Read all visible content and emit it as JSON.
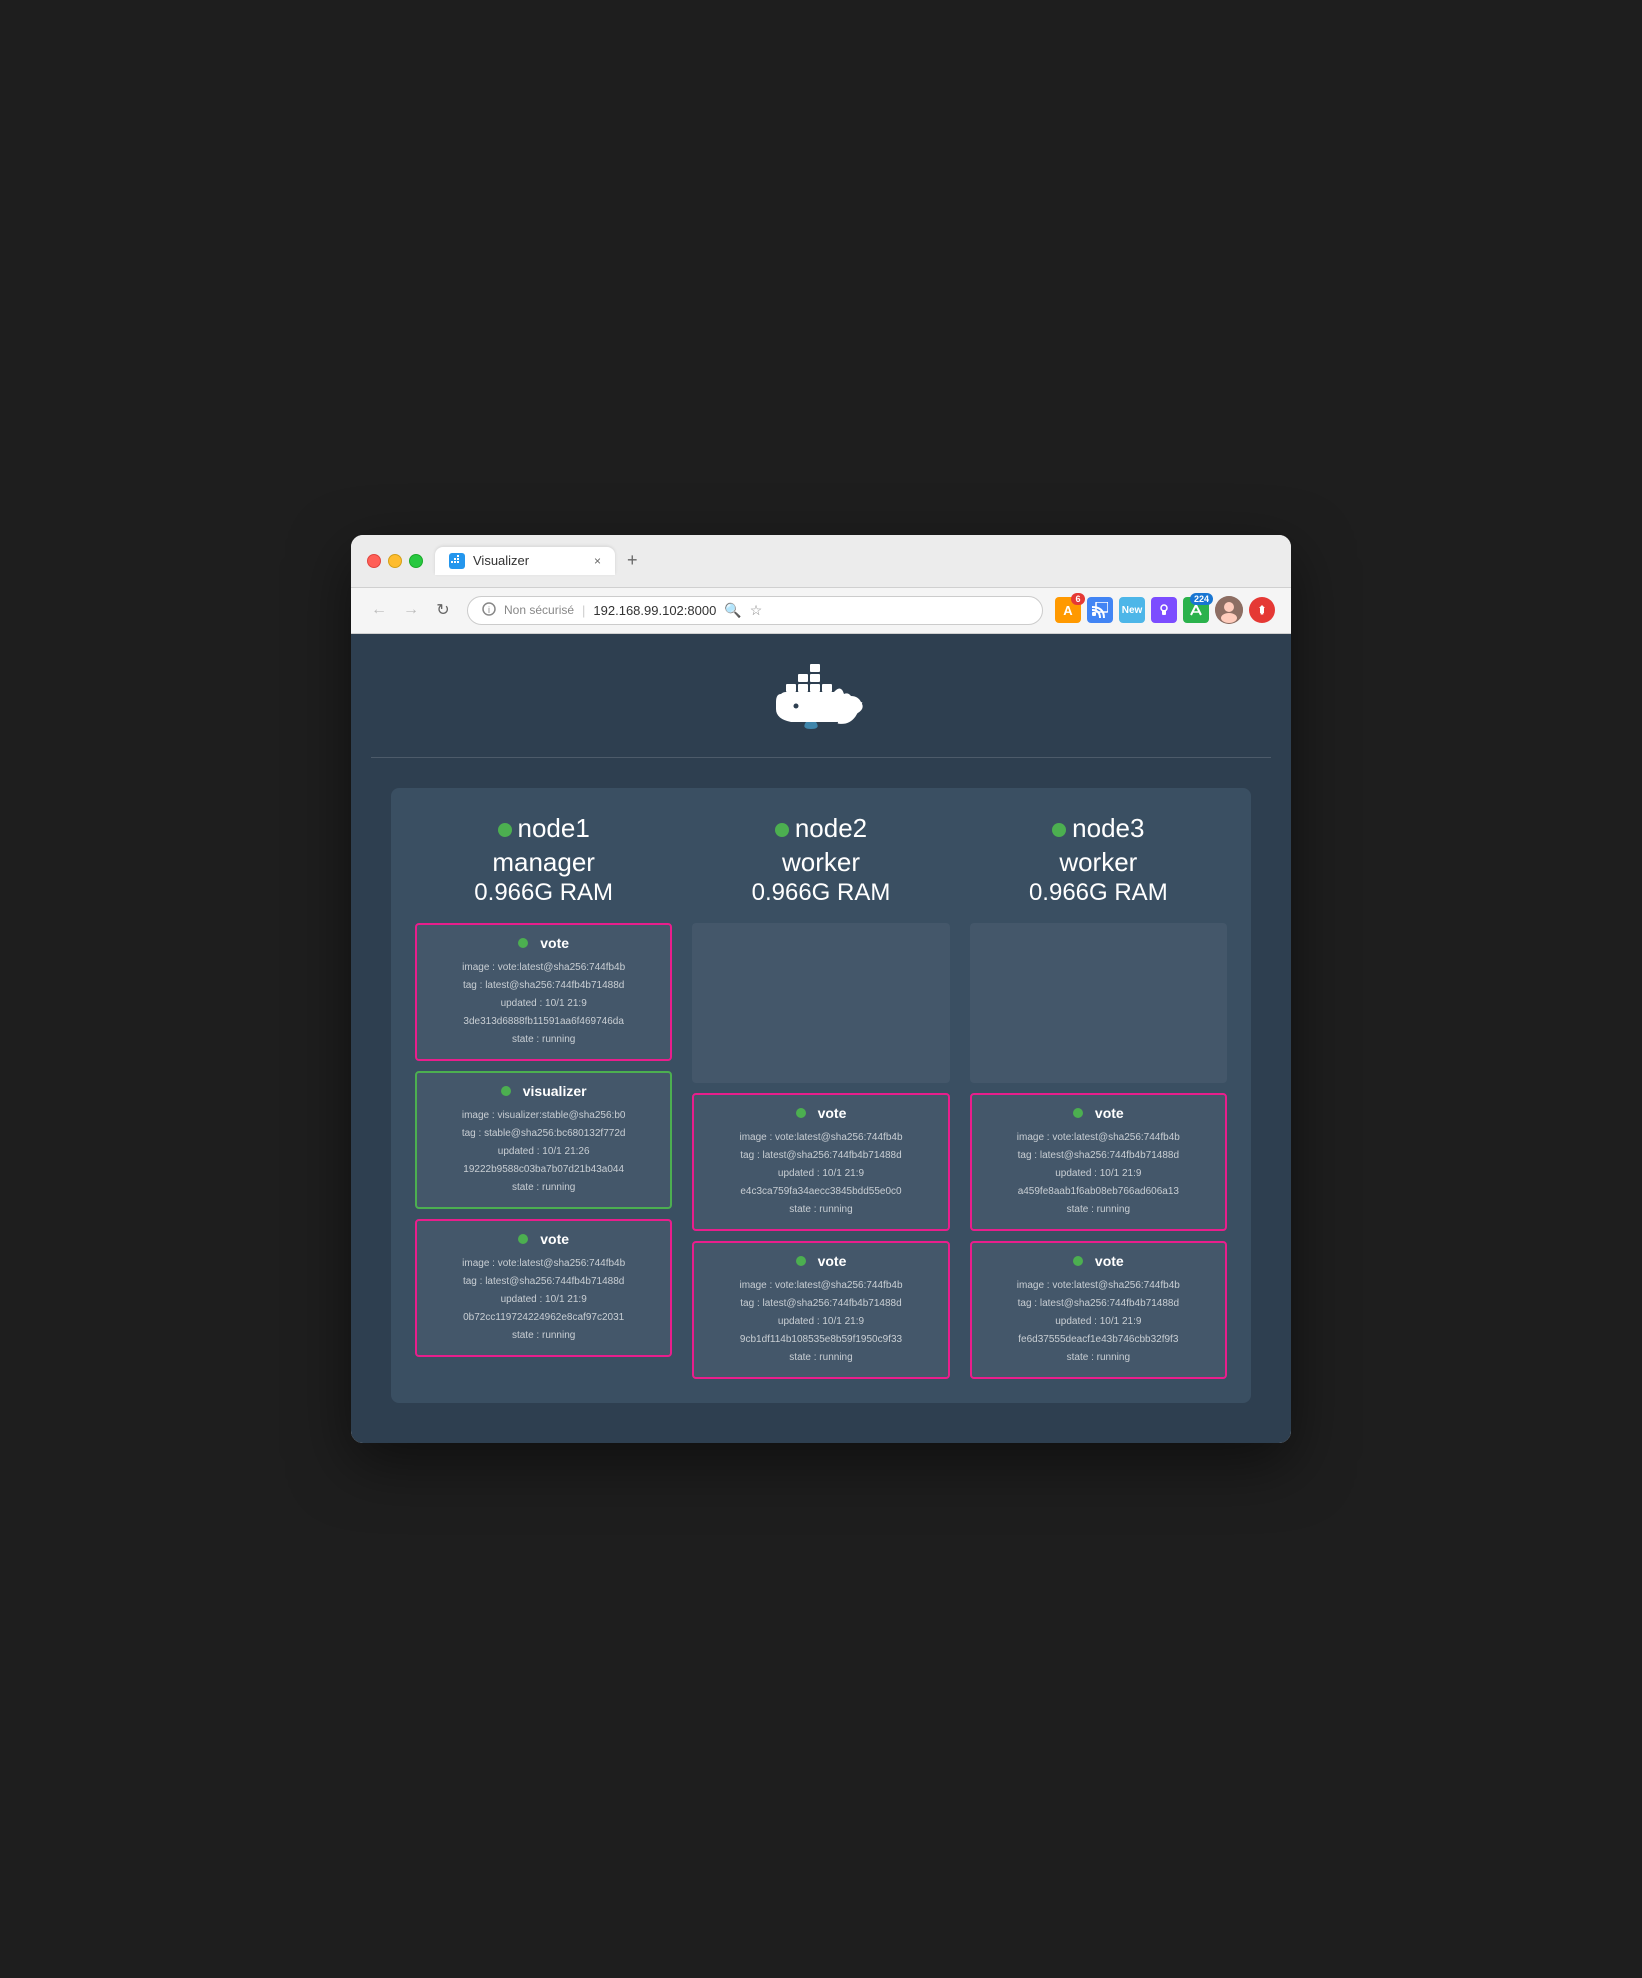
{
  "browser": {
    "tab_title": "Visualizer",
    "tab_close": "×",
    "tab_new": "+",
    "url_security": "Non sécurisé",
    "url_address": "192.168.99.102:8000",
    "nav_back": "←",
    "nav_forward": "→",
    "nav_refresh": "↻"
  },
  "extensions": {
    "amazon_badge": "6",
    "feedly_badge": "224",
    "new_label": "New"
  },
  "page": {
    "title": "Docker Visualizer"
  },
  "nodes": [
    {
      "name": "node1",
      "role": "manager",
      "ram": "0.966G RAM",
      "services": [
        {
          "name": "vote",
          "type": "vote",
          "image": "image : vote:latest@sha256:744fb4b",
          "tag": "tag : latest@sha256:744fb4b71488d",
          "updated": "updated : 10/1 21:9",
          "hash": "3de313d6888fb11591aa6f469746da",
          "state": "state : running"
        },
        {
          "name": "visualizer",
          "type": "visualizer",
          "image": "image : visualizer:stable@sha256:b0",
          "tag": "tag : stable@sha256:bc680132f772d",
          "updated": "updated : 10/1 21:26",
          "hash": "19222b9588c03ba7b07d21b43a044",
          "state": "state : running"
        },
        {
          "name": "vote",
          "type": "vote",
          "image": "image : vote:latest@sha256:744fb4b",
          "tag": "tag : latest@sha256:744fb4b71488d",
          "updated": "updated : 10/1 21:9",
          "hash": "0b72cc119724224962e8caf97c2031",
          "state": "state : running"
        }
      ]
    },
    {
      "name": "node2",
      "role": "worker",
      "ram": "0.966G RAM",
      "services": [
        {
          "name": "empty",
          "type": "empty"
        },
        {
          "name": "vote",
          "type": "vote",
          "image": "image : vote:latest@sha256:744fb4b",
          "tag": "tag : latest@sha256:744fb4b71488d",
          "updated": "updated : 10/1 21:9",
          "hash": "e4c3ca759fa34aecc3845bdd55e0c0",
          "state": "state : running"
        },
        {
          "name": "vote",
          "type": "vote",
          "image": "image : vote:latest@sha256:744fb4b",
          "tag": "tag : latest@sha256:744fb4b71488d",
          "updated": "updated : 10/1 21:9",
          "hash": "9cb1df114b108535e8b59f1950c9f33",
          "state": "state : running"
        }
      ]
    },
    {
      "name": "node3",
      "role": "worker",
      "ram": "0.966G RAM",
      "services": [
        {
          "name": "empty",
          "type": "empty"
        },
        {
          "name": "vote",
          "type": "vote",
          "image": "image : vote:latest@sha256:744fb4b",
          "tag": "tag : latest@sha256:744fb4b71488d",
          "updated": "updated : 10/1 21:9",
          "hash": "a459fe8aab1f6ab08eb766ad606a13",
          "state": "state : running"
        },
        {
          "name": "vote",
          "type": "vote",
          "image": "image : vote:latest@sha256:744fb4b",
          "tag": "tag : latest@sha256:744fb4b71488d",
          "updated": "updated : 10/1 21:9",
          "hash": "fe6d37555deacf1e43b746cbb32f9f3",
          "state": "state : running"
        }
      ]
    }
  ]
}
